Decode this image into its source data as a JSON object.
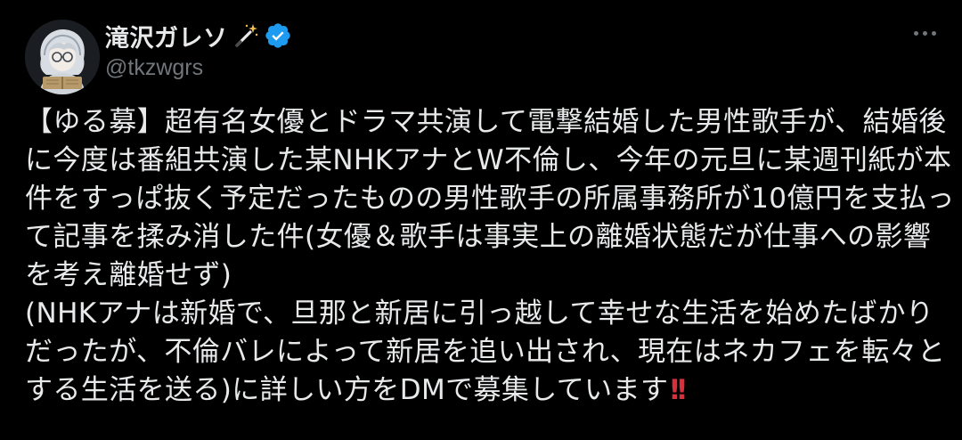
{
  "author": {
    "display_name": "滝沢ガレソ",
    "handle": "@tkzwgrs",
    "icons": [
      "avatar",
      "magic-wand-icon",
      "verified-badge-icon"
    ]
  },
  "more_button": {
    "icon": "more-horizontal-icon"
  },
  "tweet": {
    "lines": [
      "【ゆる募】超有名女優とドラマ共演して電撃結婚した男性歌手が、結婚後",
      "に今度は番組共演した某NHKアナとW不倫し、今年の元旦に某週刊紙が本",
      "件をすっぱ抜く予定だったものの男性歌手の所属事務所が10億円を支払っ",
      "て記事を揉み消した件(女優＆歌手は事実上の離婚状態だが仕事への影響",
      "を考え離婚せず)",
      "(NHKアナは新婚で、旦那と新居に引っ越して幸せな生活を始めたばかり",
      "だったが、不倫バレによって新居を追い出され、現在はネカフェを転々と",
      "する生活を送る)に詳しい方をDMで募集しています"
    ],
    "end_emoji": "‼️",
    "end_emoji_glyph": "!!"
  },
  "colors": {
    "background": "#000000",
    "text_primary": "#e7e9ea",
    "text_secondary": "#71767b",
    "verified": "#1d9bf0",
    "emoji_red": "#d8303a"
  }
}
